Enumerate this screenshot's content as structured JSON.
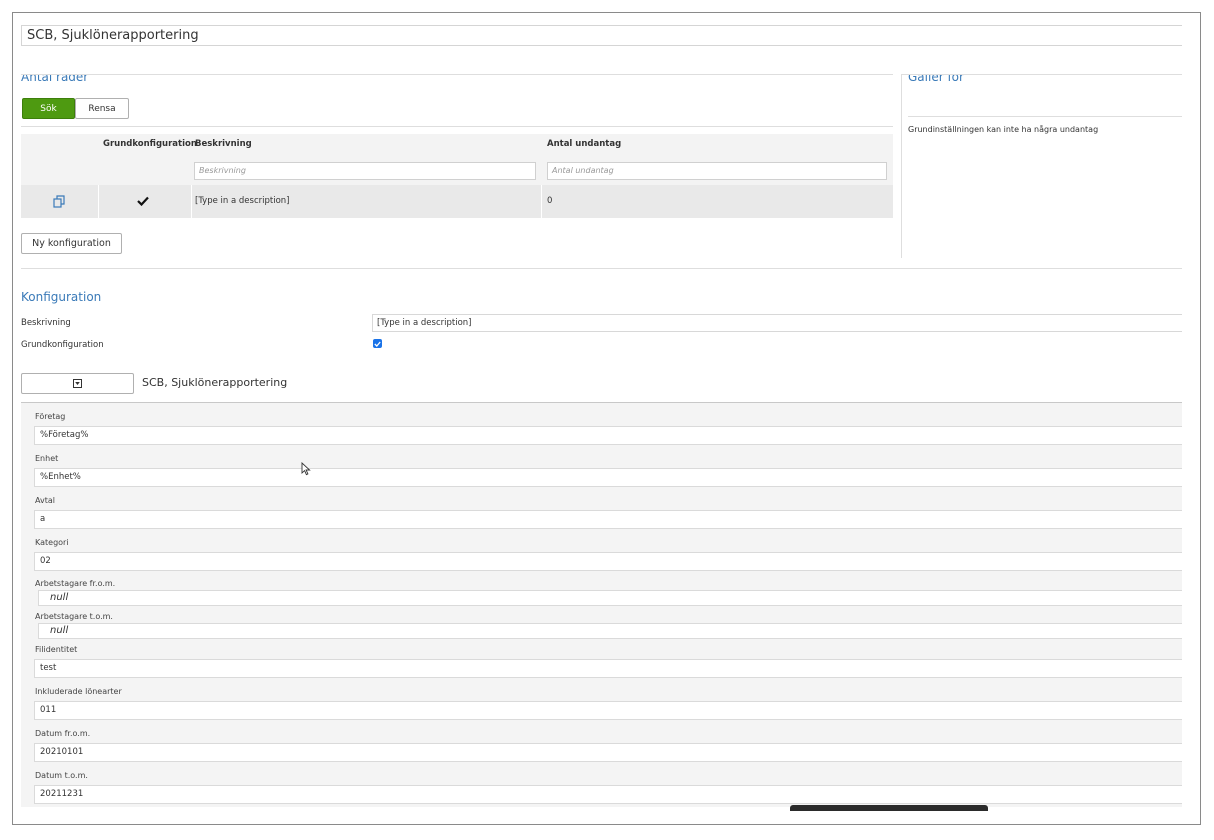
{
  "window": {
    "title": "SCB, Sjuklönerapportering"
  },
  "left_panel": {
    "title": "Antal rader",
    "search_label": "Sök",
    "clear_label": "Rensa",
    "new_config_label": "Ny konfiguration",
    "grid": {
      "columns": [
        "Grundkonfiguration",
        "Beskrivning",
        "Antal undantag"
      ],
      "filters": {
        "description_placeholder": "Beskrivning",
        "exceptions_placeholder": "Antal undantag"
      },
      "rows": [
        {
          "icon": "copy-icon",
          "is_base": true,
          "description": "[Type in a description]",
          "exceptions": "0"
        }
      ]
    }
  },
  "right_panel": {
    "title": "Gäller för",
    "note": "Grundinställningen kan inte ha några undantag"
  },
  "config": {
    "title": "Konfiguration",
    "description_label": "Beskrivning",
    "description_value": "[Type in a description]",
    "base_label": "Grundkonfiguration",
    "base_checked": true,
    "collapse_icon": "collapse-toggle-icon",
    "report_name": "SCB, Sjuklönerapportering"
  },
  "params": [
    {
      "label": "Företag",
      "value": "%Företag%"
    },
    {
      "label": "Enhet",
      "value": "%Enhet%"
    },
    {
      "label": "Avtal",
      "value": "a"
    },
    {
      "label": "Kategori",
      "value": "02"
    },
    {
      "label": "Arbetstagare fr.o.m.",
      "value": "null"
    },
    {
      "label": "Arbetstagare t.o.m.",
      "value": "null"
    },
    {
      "label": "Filidentitet",
      "value": "test"
    },
    {
      "label": "Inkluderade lönearter",
      "value": "011"
    },
    {
      "label": "Datum fr.o.m.",
      "value": "20210101"
    },
    {
      "label": "Datum t.o.m.",
      "value": "20211231"
    }
  ],
  "colors": {
    "accent": "#3a7ab8",
    "primary_button": "#4e9a11",
    "checkbox": "#1a73e8"
  }
}
